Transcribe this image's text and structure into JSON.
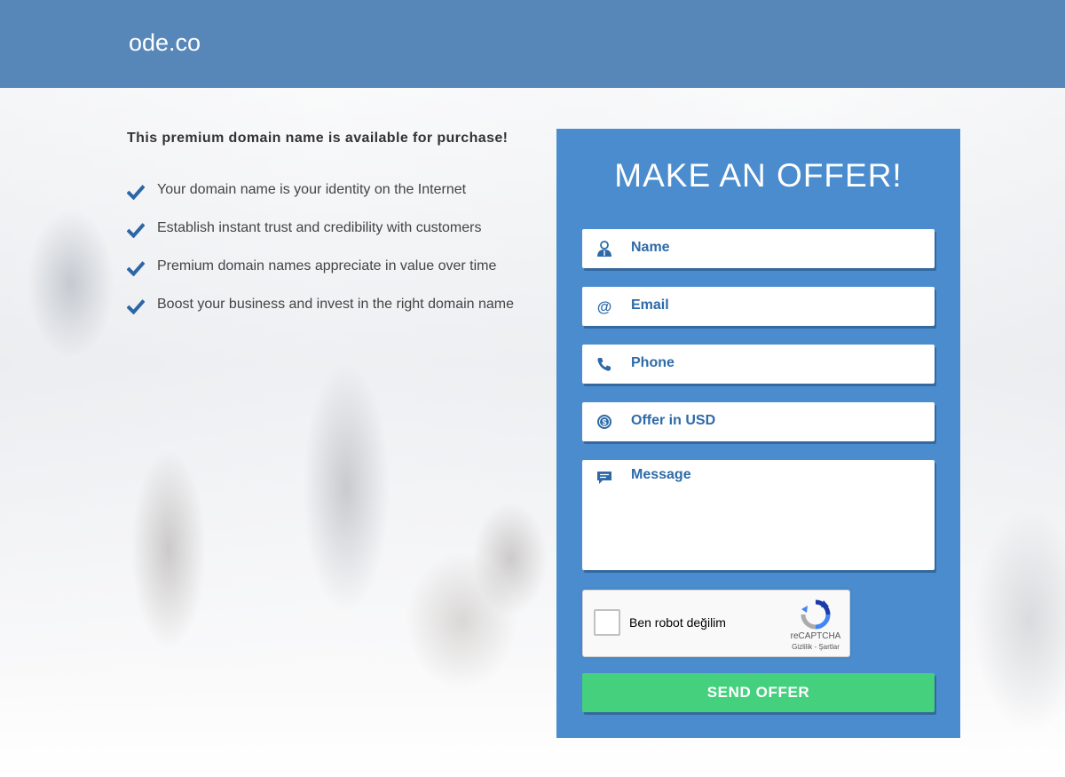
{
  "header": {
    "brand": "ode.co",
    "bg_color": "#5787b8"
  },
  "intro": {
    "headline": "This premium domain name is available for purchase!"
  },
  "features": [
    {
      "icon": "checkmark-icon",
      "text": "Your domain name is your identity on the Internet"
    },
    {
      "icon": "checkmark-icon",
      "text": "Establish instant trust and credibility with customers"
    },
    {
      "icon": "checkmark-icon",
      "text": "Premium domain names appreciate in value over time"
    },
    {
      "icon": "checkmark-icon",
      "text": "Boost your business and invest in the right domain name"
    }
  ],
  "offer_form": {
    "title": "MAKE AN OFFER!",
    "panel_color": "#4a8ccd",
    "fields": {
      "name": {
        "icon": "user-icon",
        "placeholder": "Name"
      },
      "email": {
        "icon": "at-sign-icon",
        "placeholder": "Email"
      },
      "phone": {
        "icon": "phone-icon",
        "placeholder": "Phone"
      },
      "offer": {
        "icon": "dollar-coin-icon",
        "placeholder": "Offer in USD"
      },
      "message": {
        "icon": "chat-bubble-icon",
        "placeholder": "Message"
      }
    },
    "captcha": {
      "label": "Ben robot değilim",
      "brand": "reCAPTCHA",
      "links": "Gizlilik - Şartlar"
    },
    "submit_label": "SEND OFFER",
    "submit_color": "#45d07e"
  }
}
